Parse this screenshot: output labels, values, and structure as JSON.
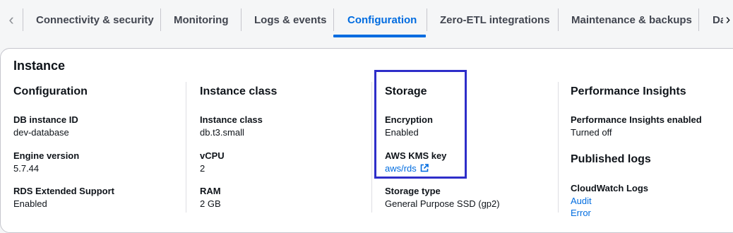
{
  "tabs": [
    {
      "label": "Connectivity & security"
    },
    {
      "label": "Monitoring"
    },
    {
      "label": "Logs & events"
    },
    {
      "label": "Configuration"
    },
    {
      "label": "Zero-ETL integrations"
    },
    {
      "label": "Maintenance & backups"
    },
    {
      "label": "Da"
    }
  ],
  "active_tab": "Configuration",
  "instance": {
    "title": "Instance",
    "configuration": {
      "title": "Configuration",
      "items": [
        {
          "key": "DB instance ID",
          "value": "dev-database"
        },
        {
          "key": "Engine version",
          "value": "5.7.44"
        },
        {
          "key": "RDS Extended Support",
          "value": "Enabled"
        }
      ]
    },
    "instance_class": {
      "title": "Instance class",
      "items": [
        {
          "key": "Instance class",
          "value": "db.t3.small"
        },
        {
          "key": "vCPU",
          "value": "2"
        },
        {
          "key": "RAM",
          "value": "2 GB"
        }
      ]
    },
    "storage": {
      "title": "Storage",
      "items": [
        {
          "key": "Encryption",
          "value": "Enabled"
        },
        {
          "key": "AWS KMS key",
          "value": "aws/rds"
        },
        {
          "key": "Storage type",
          "value": "General Purpose SSD (gp2)"
        }
      ]
    },
    "performance_insights": {
      "title": "Performance Insights",
      "items": [
        {
          "key": "Performance Insights enabled",
          "value": "Turned off"
        }
      ]
    },
    "published_logs": {
      "title": "Published logs",
      "cloudwatch_label": "CloudWatch Logs",
      "links": [
        "Audit",
        "Error"
      ]
    }
  },
  "colors": {
    "accent": "#006ce0",
    "highlight_box": "#2e2ec9"
  }
}
